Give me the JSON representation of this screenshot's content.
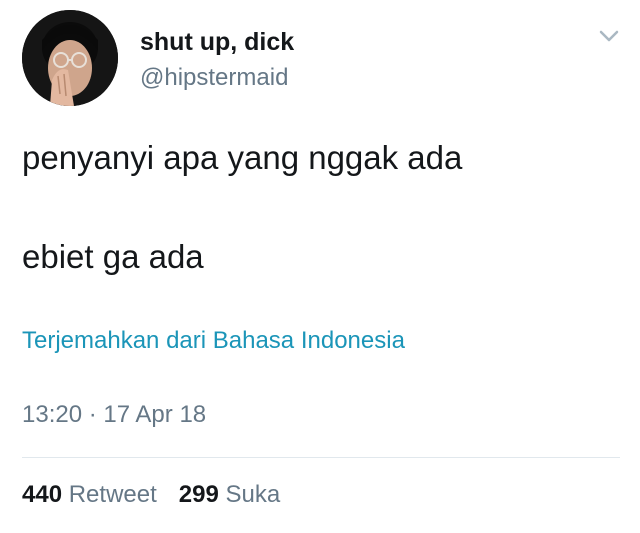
{
  "author": {
    "display_name": "shut up, dick",
    "handle": "@hipstermaid",
    "avatar_icon": "user-avatar-photo"
  },
  "menu": {
    "icon": "chevron-down-icon"
  },
  "tweet": {
    "lines": [
      "penyanyi apa yang nggak ada",
      "ebiet ga ada"
    ],
    "translate_label": "Terjemahkan dari Bahasa Indonesia",
    "timestamp": "13:20 · 17 Apr 18"
  },
  "stats": {
    "retweets_count": "440",
    "retweets_label": "Retweet",
    "likes_count": "299",
    "likes_label": "Suka"
  },
  "colors": {
    "primary_text": "#14171a",
    "secondary_text": "#657786",
    "link": "#1b95b8",
    "divider": "#e1e8ed"
  }
}
